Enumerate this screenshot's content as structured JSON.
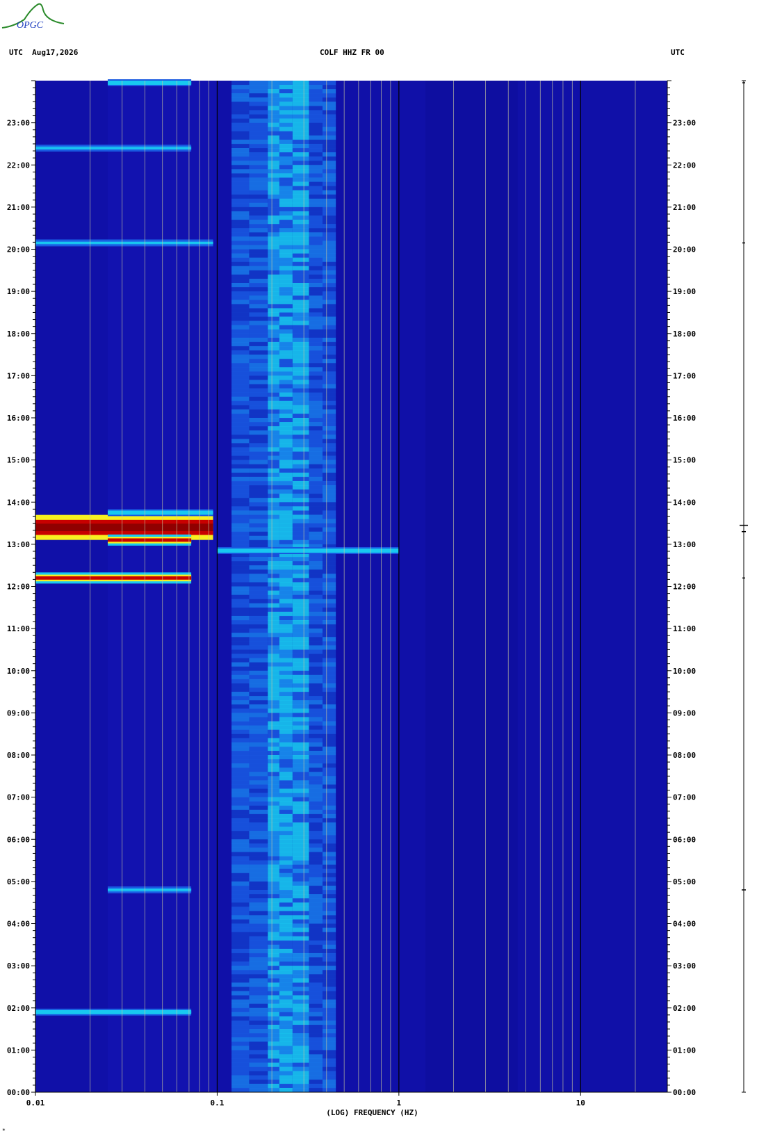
{
  "header": {
    "timezone_left": "UTC",
    "date": "Aug17,2026",
    "station_title": "COLF HHZ FR 00",
    "timezone_right": "UTC"
  },
  "logo": {
    "text": "OPGC"
  },
  "footer_mark": "*",
  "colors": {
    "background": "#1010a8",
    "low_band": "#1a1aa0",
    "noise_blue": "#1858e0",
    "noise_cyan": "#18c8f0",
    "event_yellow": "#f8f020",
    "event_red": "#c80000",
    "event_darkred": "#900000",
    "grid_minor": "#c8c8a0",
    "grid_major": "#000000"
  },
  "chart_data": {
    "type": "heatmap",
    "title": "COLF HHZ FR 00",
    "xlabel": "(LOG) FREQUENCY (HZ)",
    "ylabel": "UTC",
    "x_scale": "log",
    "xlim": [
      0.01,
      30
    ],
    "x_ticks": [
      {
        "value": 0.01,
        "label": "0.01"
      },
      {
        "value": 0.1,
        "label": "0.1"
      },
      {
        "value": 1,
        "label": "1"
      },
      {
        "value": 10,
        "label": "10"
      }
    ],
    "ylim_hours": [
      0,
      24
    ],
    "y_ticks": [
      {
        "hour": 0,
        "label": "00:00"
      },
      {
        "hour": 1,
        "label": "01:00"
      },
      {
        "hour": 2,
        "label": "02:00"
      },
      {
        "hour": 3,
        "label": "03:00"
      },
      {
        "hour": 4,
        "label": "04:00"
      },
      {
        "hour": 5,
        "label": "05:00"
      },
      {
        "hour": 6,
        "label": "06:00"
      },
      {
        "hour": 7,
        "label": "07:00"
      },
      {
        "hour": 8,
        "label": "08:00"
      },
      {
        "hour": 9,
        "label": "09:00"
      },
      {
        "hour": 10,
        "label": "10:00"
      },
      {
        "hour": 11,
        "label": "11:00"
      },
      {
        "hour": 12,
        "label": "12:00"
      },
      {
        "hour": 13,
        "label": "13:00"
      },
      {
        "hour": 14,
        "label": "14:00"
      },
      {
        "hour": 15,
        "label": "15:00"
      },
      {
        "hour": 16,
        "label": "16:00"
      },
      {
        "hour": 17,
        "label": "17:00"
      },
      {
        "hour": 18,
        "label": "18:00"
      },
      {
        "hour": 19,
        "label": "19:00"
      },
      {
        "hour": 20,
        "label": "20:00"
      },
      {
        "hour": 21,
        "label": "21:00"
      },
      {
        "hour": 22,
        "label": "22:00"
      },
      {
        "hour": 23,
        "label": "23:00"
      }
    ],
    "microseism_band_hz": [
      0.12,
      0.45
    ],
    "microseism_peak_hz": [
      0.19,
      0.32
    ],
    "events": [
      {
        "hour": 13.4,
        "fmin": 0.01,
        "fmax": 0.095,
        "level": "very_high"
      },
      {
        "hour": 12.2,
        "fmin": 0.01,
        "fmax": 0.072,
        "level": "high"
      },
      {
        "hour": 13.1,
        "fmin": 0.025,
        "fmax": 0.072,
        "level": "high"
      },
      {
        "hour": 13.75,
        "fmin": 0.025,
        "fmax": 0.095,
        "level": "medium"
      },
      {
        "hour": 12.85,
        "fmin": 0.1,
        "fmax": 1.0,
        "level": "medium"
      },
      {
        "hour": 1.9,
        "fmin": 0.01,
        "fmax": 0.072,
        "level": "medium"
      },
      {
        "hour": 20.15,
        "fmin": 0.01,
        "fmax": 0.095,
        "level": "low"
      },
      {
        "hour": 22.4,
        "fmin": 0.01,
        "fmax": 0.072,
        "level": "low"
      },
      {
        "hour": 23.95,
        "fmin": 0.025,
        "fmax": 0.072,
        "level": "medium"
      },
      {
        "hour": 4.8,
        "fmin": 0.025,
        "fmax": 0.072,
        "level": "low"
      }
    ],
    "grid": true
  }
}
